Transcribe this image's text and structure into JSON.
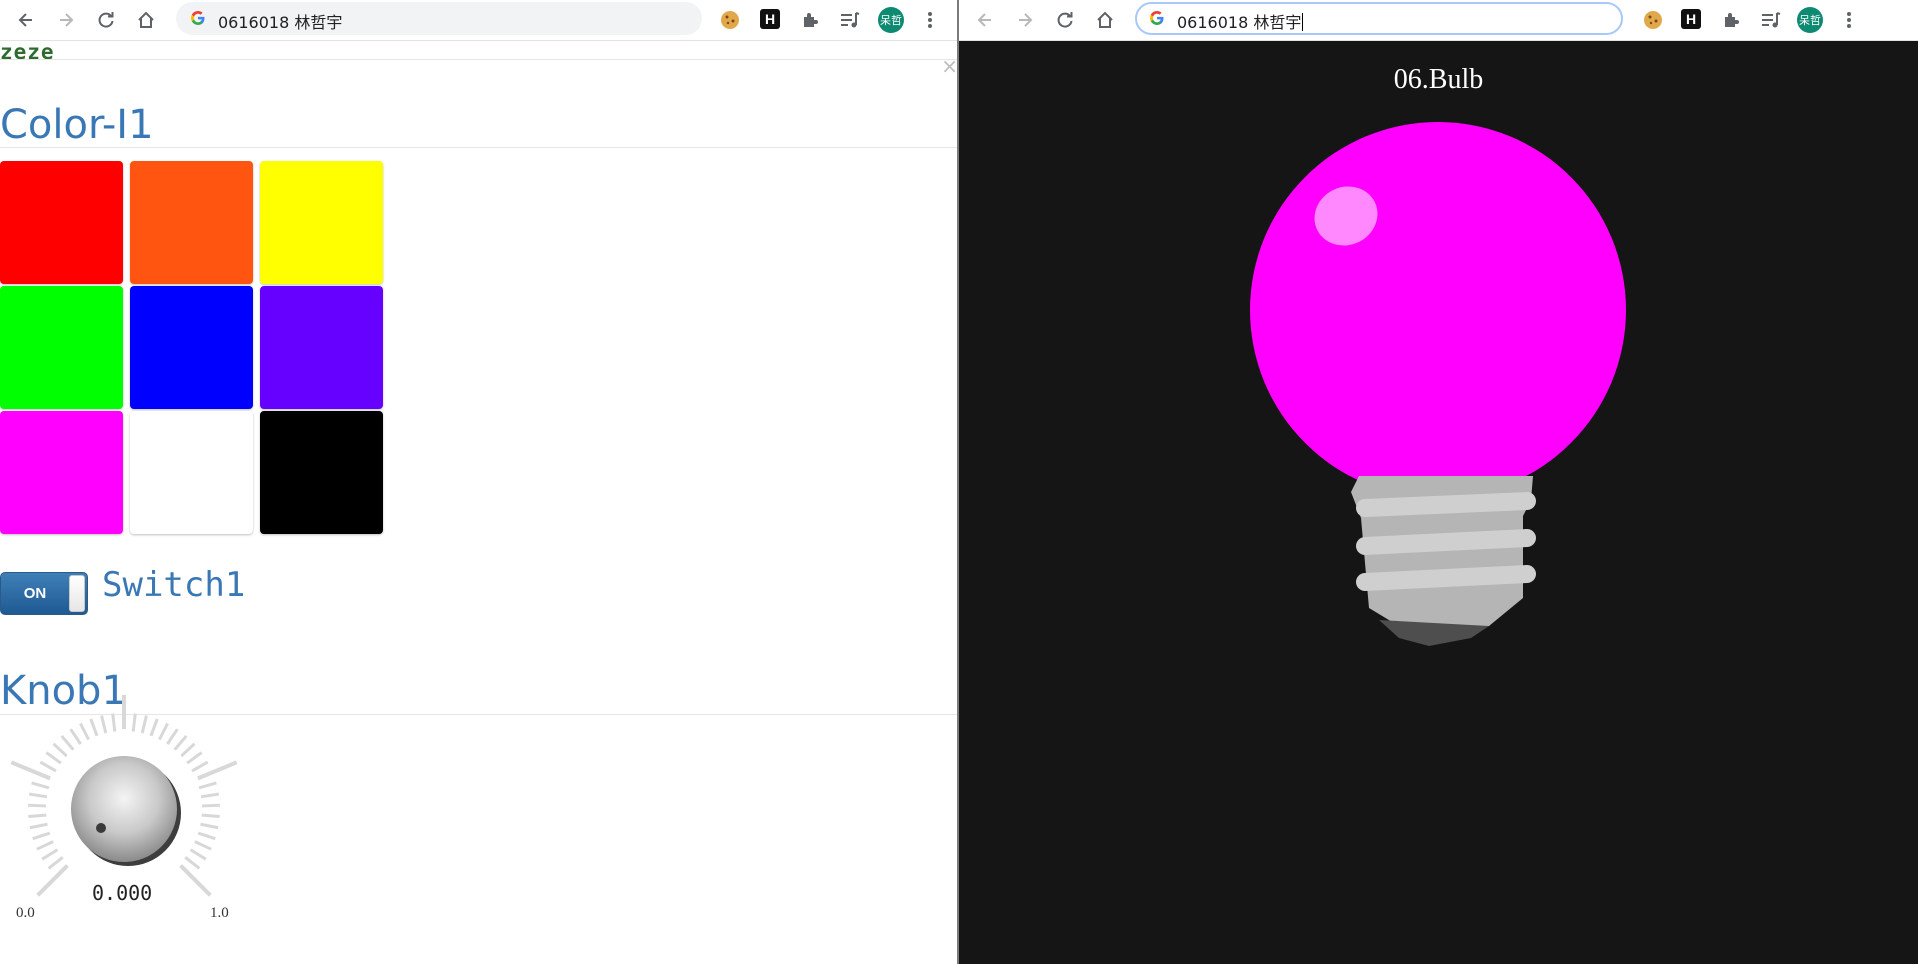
{
  "left_window": {
    "address_text": "0616018 林哲宇",
    "avatar_text": "呆哲",
    "extension_h": "H",
    "app_header": "zeze",
    "close_symbol": "×",
    "color_section": {
      "title": "Color-I1",
      "swatches": [
        {
          "color": "#ff0000"
        },
        {
          "color": "#ff5511"
        },
        {
          "color": "#ffff00"
        },
        {
          "color": "#00ff00"
        },
        {
          "color": "#0000ff"
        },
        {
          "color": "#6600ff"
        },
        {
          "color": "#ff00ff"
        },
        {
          "color": "#ffffff"
        },
        {
          "color": "#000000"
        }
      ]
    },
    "switch": {
      "state_label": "ON",
      "label": "Switch1"
    },
    "knob": {
      "title": "Knob1",
      "value": "0.000",
      "min_label": "0.0",
      "max_label": "1.0"
    }
  },
  "right_window": {
    "address_text": "0616018 林哲宇",
    "avatar_text": "呆哲",
    "extension_h": "H",
    "bulb": {
      "title": "06.Bulb",
      "color": "#ff00ff"
    }
  }
}
